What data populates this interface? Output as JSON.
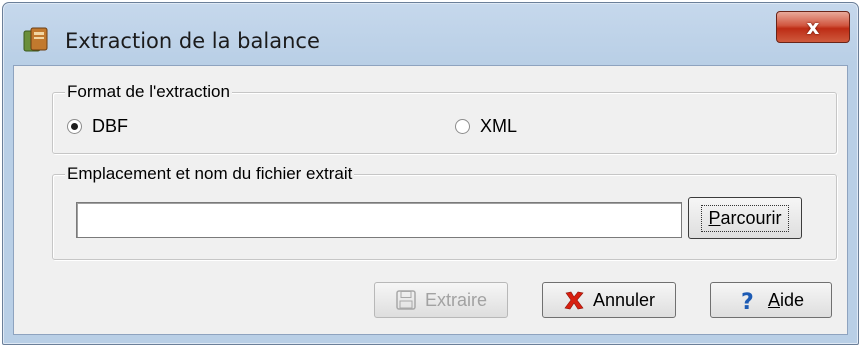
{
  "window": {
    "title": "Extraction de la balance",
    "close_label": "x"
  },
  "format_group": {
    "legend": "Format de l'extraction",
    "options": [
      {
        "label": "DBF",
        "checked": true
      },
      {
        "label": "XML",
        "checked": false
      }
    ]
  },
  "file_group": {
    "legend": "Emplacement et nom du fichier extrait",
    "path_value": "",
    "browse_label_accel": "P",
    "browse_label_rest": "arcourir"
  },
  "buttons": {
    "extract_label": "Extraire",
    "cancel_label": "Annuler",
    "help_label_accel": "A",
    "help_label_rest": "ide"
  }
}
